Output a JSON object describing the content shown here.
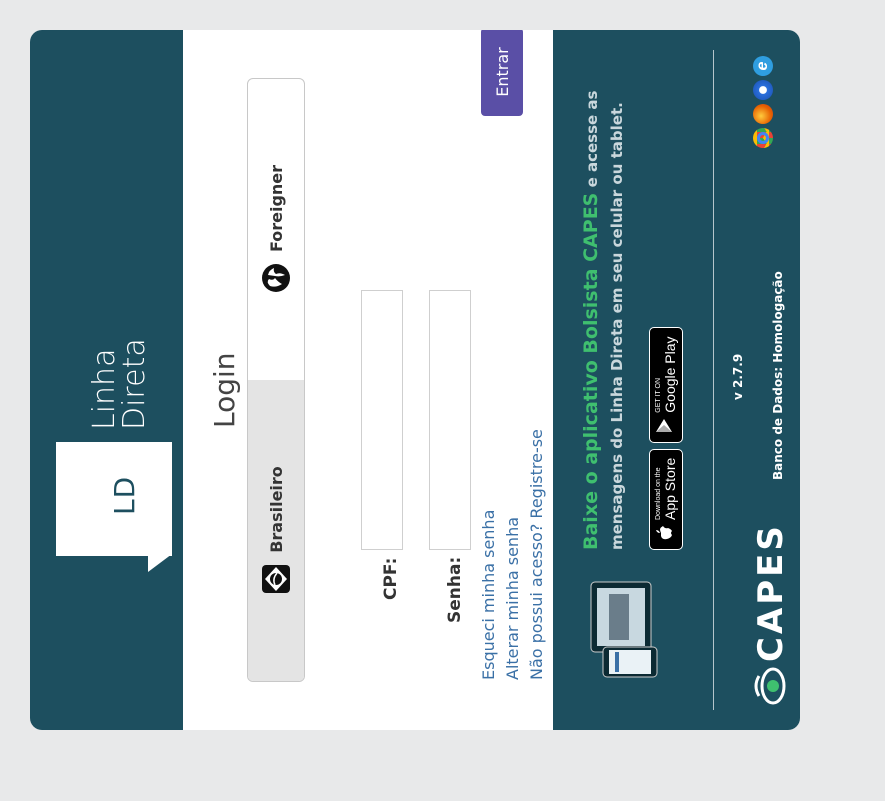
{
  "header": {
    "logo_text": "LD",
    "title_line1": "Linha",
    "title_line2": "Direta"
  },
  "login": {
    "title": "Login",
    "tabs": [
      {
        "label": "Brasileiro",
        "icon": "brazil-icon",
        "active": true
      },
      {
        "label": "Foreigner",
        "icon": "globe-icon",
        "active": false
      }
    ],
    "cpf_label": "CPF:",
    "cpf_value": "",
    "senha_label": "Senha:",
    "senha_value": "",
    "submit_label": "Entrar",
    "links": [
      "Esqueci minha senha",
      "Alterar minha senha",
      "Não possui acesso? Registre-se"
    ]
  },
  "footer": {
    "promo_title": "Baixe o aplicativo Bolsista CAPES",
    "promo_text": " e acesse as mensagens do Linha Direta em seu celular ou tablet.",
    "app_store_small": "Download on the",
    "app_store_big": "App Store",
    "google_play_small": "GET IT ON",
    "google_play_big": "Google Play",
    "brand": "CAPES",
    "version": "v 2.7.9",
    "database": "Banco de Dados: Homologação",
    "colors": {
      "accent": "#1d4f5f",
      "button": "#5a4fa6",
      "promo": "#3fbf6f"
    }
  }
}
